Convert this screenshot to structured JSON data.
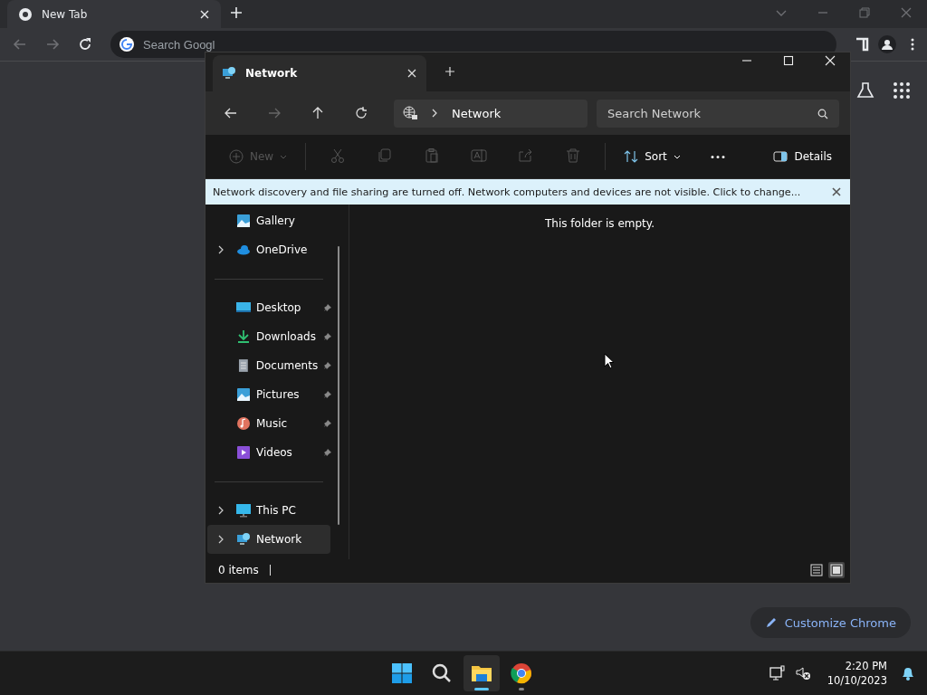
{
  "browser": {
    "tab": {
      "title": "New Tab"
    },
    "address": {
      "placeholder": "Search Googl"
    },
    "customize_button": "Customize Chrome"
  },
  "explorer": {
    "tab": {
      "title": "Network"
    },
    "breadcrumb": "Network",
    "search": {
      "placeholder": "Search Network"
    },
    "toolbar": {
      "new": {
        "label": "New",
        "disabled": true
      },
      "actions": [
        {
          "disabled": true
        },
        {
          "disabled": true
        },
        {
          "disabled": true
        },
        {
          "disabled": true
        },
        {
          "disabled": true
        },
        {
          "disabled": true
        }
      ],
      "sort": "Sort",
      "details": "Details"
    },
    "banner": "Network discovery and file sharing are turned off. Network computers and devices are not visible. Click to change...",
    "sidebar": {
      "sections": [
        [
          {
            "label": "Gallery",
            "expandable": false,
            "pinned": false,
            "selected": false
          },
          {
            "label": "OneDrive",
            "expandable": true,
            "pinned": false,
            "selected": false
          }
        ],
        [
          {
            "label": "Desktop",
            "expandable": false,
            "pinned": true,
            "selected": false
          },
          {
            "label": "Downloads",
            "expandable": false,
            "pinned": true,
            "selected": false
          },
          {
            "label": "Documents",
            "expandable": false,
            "pinned": true,
            "selected": false
          },
          {
            "label": "Pictures",
            "expandable": false,
            "pinned": true,
            "selected": false
          },
          {
            "label": "Music",
            "expandable": false,
            "pinned": true,
            "selected": false
          },
          {
            "label": "Videos",
            "expandable": false,
            "pinned": true,
            "selected": false
          }
        ],
        [
          {
            "label": "This PC",
            "expandable": true,
            "pinned": false,
            "selected": false
          },
          {
            "label": "Network",
            "expandable": true,
            "pinned": false,
            "selected": true
          }
        ]
      ]
    },
    "empty_message": "This folder is empty.",
    "status": "0 items",
    "view": {
      "details_selected": false,
      "tiles_selected": true
    }
  },
  "taskbar": {
    "apps": [
      {
        "running": false
      },
      {
        "running": false
      },
      {
        "running": true
      },
      {
        "running": true
      }
    ],
    "time": "2:20 PM",
    "date": "10/10/2023"
  }
}
